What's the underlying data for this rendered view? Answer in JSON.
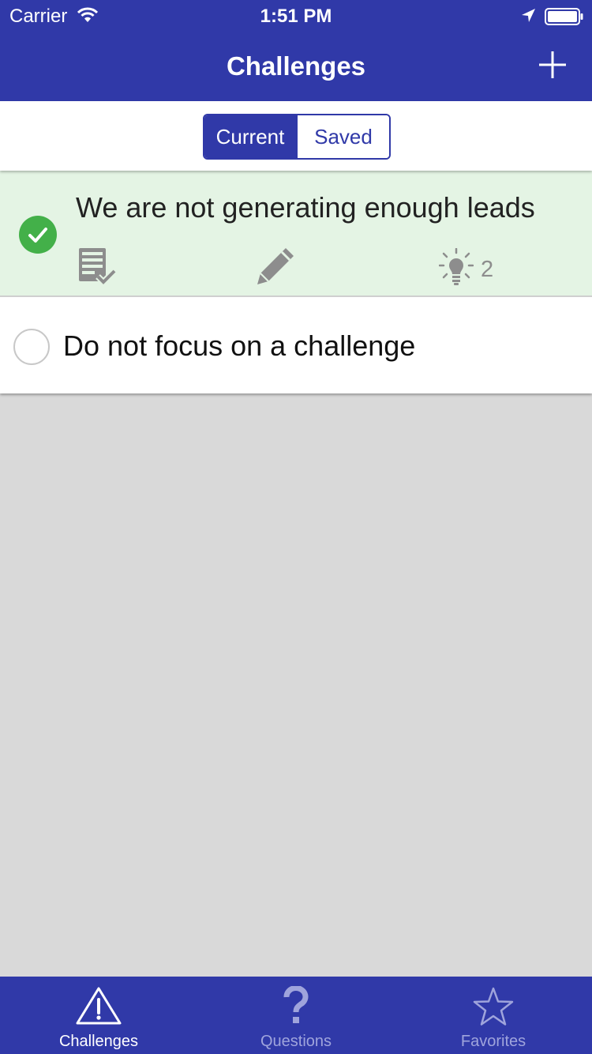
{
  "status_bar": {
    "carrier": "Carrier",
    "time": "1:51 PM",
    "icons": [
      "wifi-icon",
      "location-arrow-icon",
      "battery-icon"
    ]
  },
  "nav": {
    "title": "Challenges",
    "add_icon": "plus-icon"
  },
  "segments": {
    "current": "Current",
    "saved": "Saved",
    "selected": "Current"
  },
  "challenges": [
    {
      "text": "We are not generating enough leads",
      "selected": true,
      "status_icon": "checkmark-circle-icon",
      "actions": [
        "notes-check-icon",
        "pencil-icon",
        "lightbulb-icon"
      ],
      "ideas_count": "2"
    },
    {
      "text": "Do not focus on a challenge",
      "selected": false,
      "status_icon": "empty-radio-icon"
    }
  ],
  "tabs": [
    {
      "label": "Challenges",
      "icon": "warning-triangle-icon",
      "selected": true
    },
    {
      "label": "Questions",
      "icon": "question-mark-icon",
      "selected": false
    },
    {
      "label": "Favorites",
      "icon": "star-icon",
      "selected": false
    }
  ],
  "colors": {
    "primary": "#3039a8",
    "selected_row": "#e4f4e4",
    "check_green": "#43b049",
    "icon_gray": "#8d8d8d",
    "inactive_tab": "#9fa4dc",
    "background": "#d9d9d9"
  }
}
